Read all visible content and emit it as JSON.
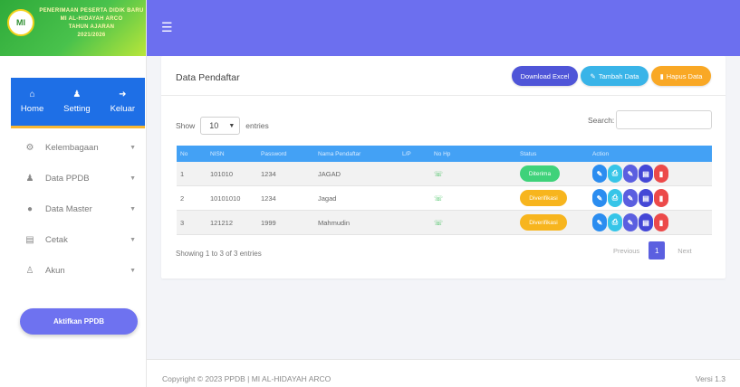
{
  "brand": {
    "logo_text": "MI",
    "line1": "PENERIMAAN PESERTA DIDIK BARU",
    "line2": "MI AL-HIDAYAH ARCO",
    "line3": "TAHUN AJARAN",
    "line4": "2021/2026"
  },
  "topnav": {
    "home": "Home",
    "setting": "Setting",
    "keluar": "Keluar"
  },
  "menu": [
    {
      "label": "Kelembagaan",
      "icon": "gear-icon"
    },
    {
      "label": "Data PPDB",
      "icon": "users-icon"
    },
    {
      "label": "Data Master",
      "icon": "tint-icon"
    },
    {
      "label": "Cetak",
      "icon": "file-icon"
    },
    {
      "label": "Akun",
      "icon": "user-icon"
    }
  ],
  "sidebar_button": "Aktifkan PPDB",
  "card": {
    "title": "Data Pendaftar",
    "btn_excel": "Download Excel",
    "btn_tambah": "Tambah Data",
    "btn_hapus": "Hapus Data"
  },
  "controls": {
    "show_label": "Show",
    "entries_value": "10",
    "entries_label": "entries",
    "search_label": "Search:"
  },
  "table": {
    "headers": [
      "No",
      "NISN",
      "Password",
      "Nama Pendaftar",
      "L/P",
      "No Hp",
      "Status",
      "Action"
    ],
    "rows": [
      {
        "no": "1",
        "nisn": "101010",
        "password": "1234",
        "nama": "JAGAD",
        "lp": "",
        "status": "Diterima"
      },
      {
        "no": "2",
        "nisn": "10101010",
        "password": "1234",
        "nama": "Jagad",
        "lp": "",
        "status": "Diverifikasi"
      },
      {
        "no": "3",
        "nisn": "121212",
        "password": "1999",
        "nama": "Mahmudin",
        "lp": "",
        "status": "Diverifikasi"
      }
    ]
  },
  "pagination": {
    "info": "Showing 1 to 3 of 3 entries",
    "previous": "Previous",
    "page": "1",
    "next": "Next"
  },
  "footer": {
    "copyright": "Copyright © 2023 PPDB | MI AL-HIDAYAH ARCO",
    "version": "Versi 1.3"
  },
  "colors": {
    "header": "#6c6fef",
    "topnav": "#1e6fe6",
    "table_header": "#43a1f5",
    "status_diterima": "#3fd27a",
    "status_diverifikasi": "#f7b51e"
  }
}
